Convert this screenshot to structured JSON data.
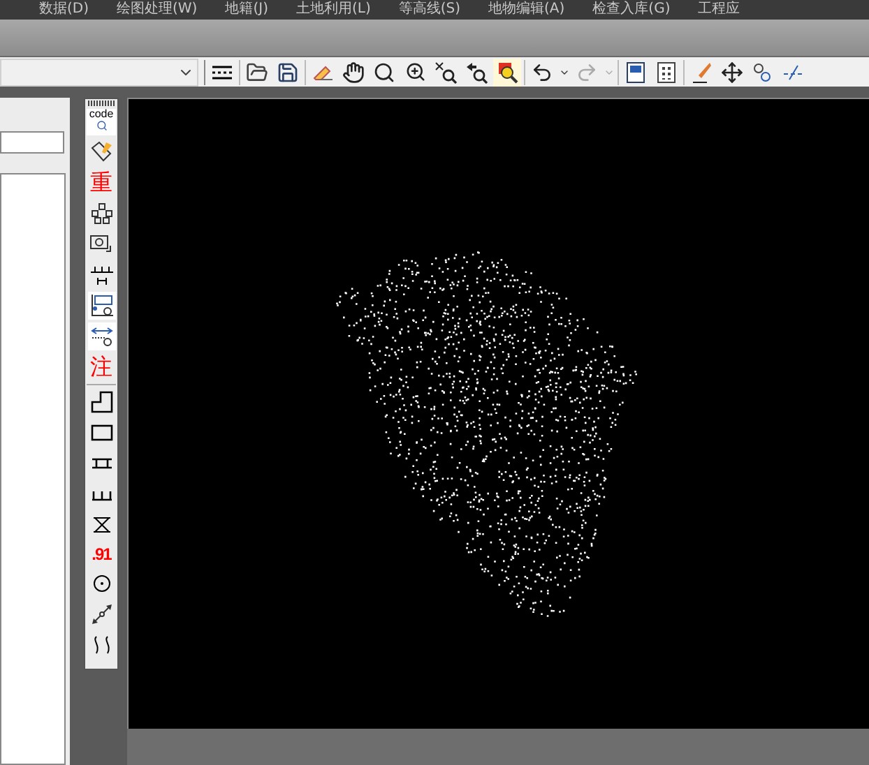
{
  "menu": [
    {
      "label": "数据(D)"
    },
    {
      "label": "绘图处理(W)"
    },
    {
      "label": "地籍(J)"
    },
    {
      "label": "土地利用(L)"
    },
    {
      "label": "等高线(S)"
    },
    {
      "label": "地物编辑(A)"
    },
    {
      "label": "检查入库(G)"
    },
    {
      "label": "工程应"
    }
  ],
  "toolbar": {
    "undo_disabled": false,
    "redo_disabled": true
  },
  "side_tools": {
    "code": "code",
    "heavy": "重",
    "note": "注",
    "decimal": ".91"
  }
}
